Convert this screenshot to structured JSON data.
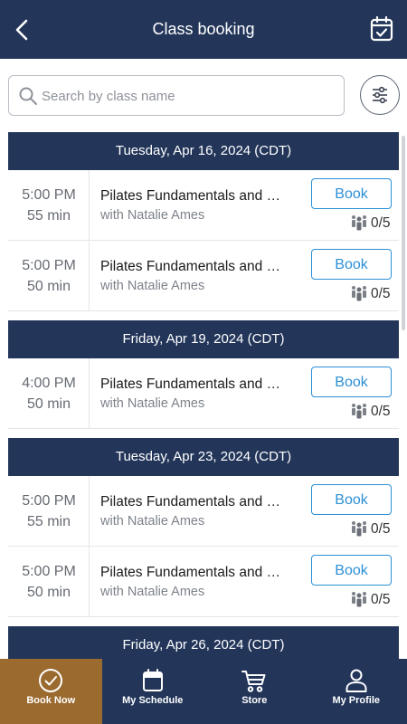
{
  "header": {
    "title": "Class booking",
    "back_icon": "chevron-left-icon",
    "calendar_icon": "calendar-check-icon"
  },
  "search": {
    "placeholder": "Search by class name",
    "value": ""
  },
  "filter_icon": "sliders-icon",
  "sections": [
    {
      "date": "Tuesday, Apr 16, 2024 (CDT)",
      "classes": [
        {
          "time": "5:00  PM",
          "duration": "55 min",
          "name": "Pilates Fundamentals and Beyond",
          "instructor": "with Natalie Ames",
          "book_label": "Book",
          "capacity": "0/5"
        },
        {
          "time": "5:00  PM",
          "duration": "50 min",
          "name": "Pilates Fundamentals and Beyond",
          "instructor": "with Natalie Ames",
          "book_label": "Book",
          "capacity": "0/5"
        }
      ]
    },
    {
      "date": "Friday, Apr 19, 2024 (CDT)",
      "classes": [
        {
          "time": "4:00  PM",
          "duration": "50 min",
          "name": "Pilates Fundamentals and Beyond",
          "instructor": "with Natalie Ames",
          "book_label": "Book",
          "capacity": "0/5"
        }
      ]
    },
    {
      "date": "Tuesday, Apr 23, 2024 (CDT)",
      "classes": [
        {
          "time": "5:00  PM",
          "duration": "55 min",
          "name": "Pilates Fundamentals and Beyond",
          "instructor": "with Natalie Ames",
          "book_label": "Book",
          "capacity": "0/5"
        },
        {
          "time": "5:00  PM",
          "duration": "50 min",
          "name": "Pilates Fundamentals and Beyond",
          "instructor": "with Natalie Ames",
          "book_label": "Book",
          "capacity": "0/5"
        }
      ]
    },
    {
      "date": "Friday, Apr 26, 2024 (CDT)",
      "classes": []
    }
  ],
  "bottom_nav": [
    {
      "label": "Book Now",
      "icon": "check-circle-icon",
      "active": true
    },
    {
      "label": "My Schedule",
      "icon": "calendar-icon",
      "active": false
    },
    {
      "label": "Store",
      "icon": "cart-icon",
      "active": false
    },
    {
      "label": "My Profile",
      "icon": "person-icon",
      "active": false
    }
  ],
  "colors": {
    "primary": "#23365a",
    "accent": "#2c8fd6",
    "active_tab": "#9b6a2f"
  }
}
